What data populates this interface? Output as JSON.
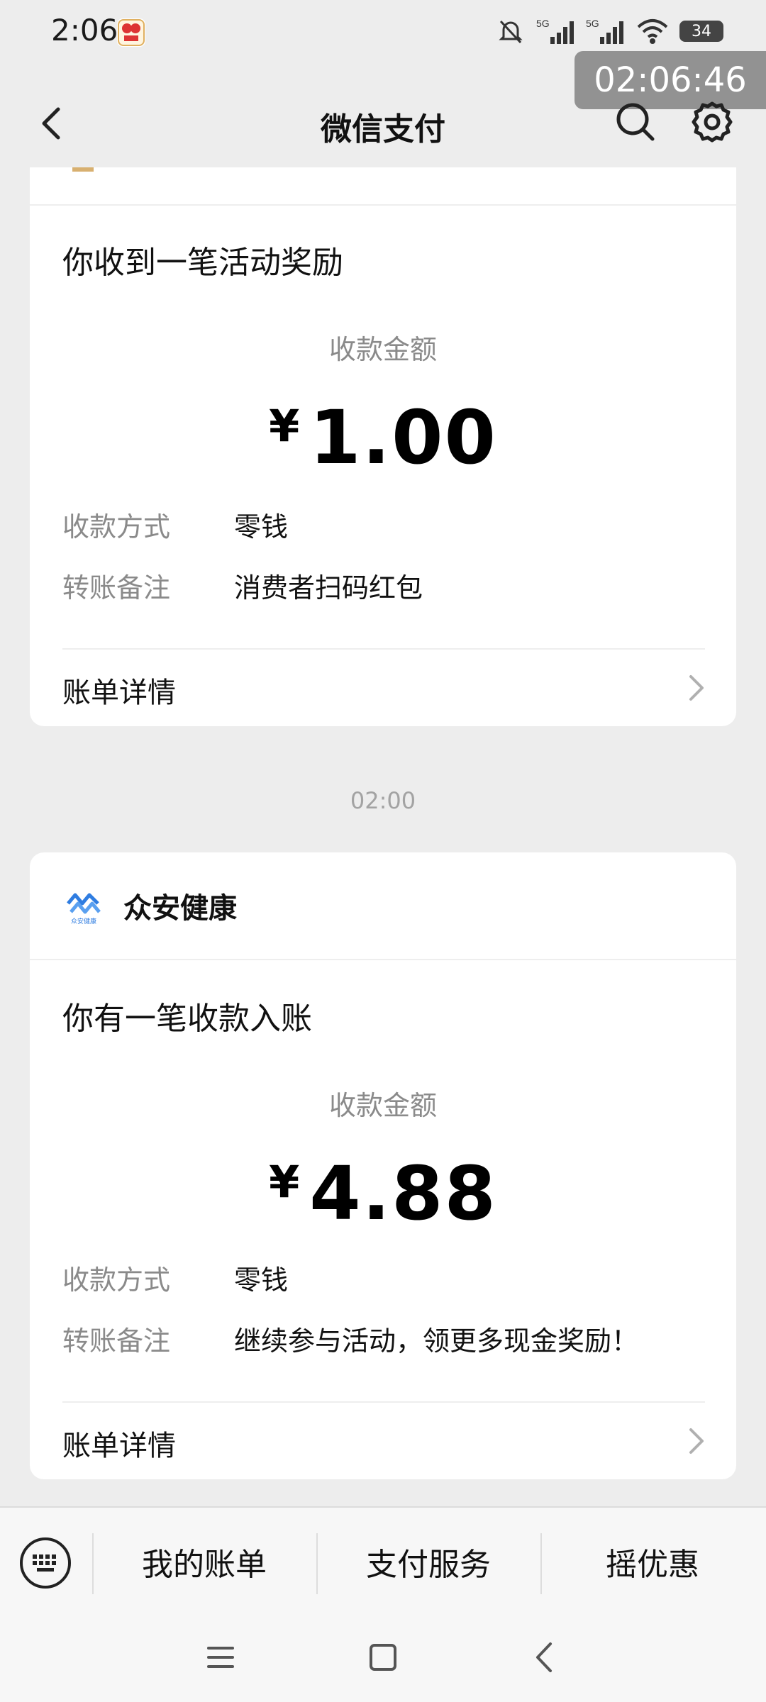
{
  "status_bar": {
    "time": "2:06",
    "battery": "34"
  },
  "timer_overlay": "02:06:46",
  "nav": {
    "title": "微信支付"
  },
  "colors": {
    "background": "#ededed",
    "card": "#ffffff",
    "label": "#8a8a8a",
    "zhongan_blue": "#2f7de1"
  },
  "cards": [
    {
      "title": "你收到一笔活动奖励",
      "amount_label": "收款金额",
      "currency": "¥",
      "amount": "1.00",
      "method_label": "收款方式",
      "method_value": "零钱",
      "note_label": "转账备注",
      "note_value": "消费者扫码红包",
      "detail_label": "账单详情"
    },
    {
      "merchant_name": "众安健康",
      "merchant_logo_text": "众安健康",
      "title": "你有一笔收款入账",
      "amount_label": "收款金额",
      "currency": "¥",
      "amount": "4.88",
      "method_label": "收款方式",
      "method_value": "零钱",
      "note_label": "转账备注",
      "note_value": "继续参与活动，领更多现金奖励！",
      "detail_label": "账单详情"
    }
  ],
  "time_separator": "02:00",
  "bottom_menu": {
    "items": [
      "我的账单",
      "支付服务",
      "摇优惠"
    ]
  }
}
